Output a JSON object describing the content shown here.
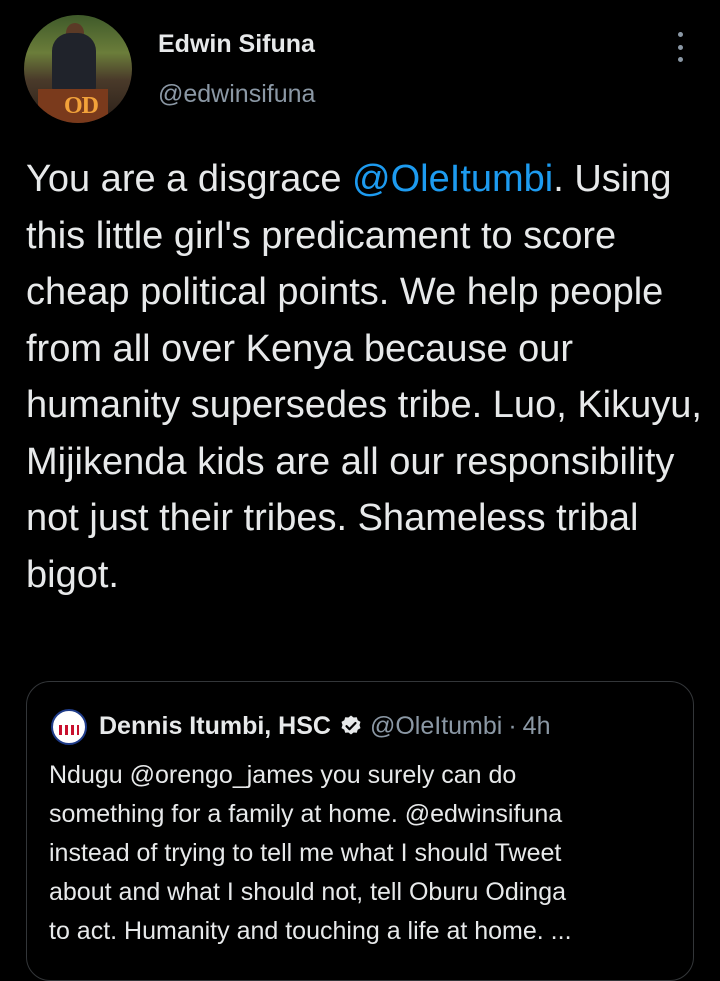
{
  "tweet": {
    "author_name": "Edwin Sifuna",
    "author_handle": "@edwinsifuna",
    "avatar_podium_text": "OD",
    "text_before": "You are a disgrace ",
    "mention": "@OleItumbi",
    "text_after": ". Using this little girl's predicament to score cheap political points. We help people from all over Kenya because our humanity supersedes tribe. Luo, Kikuyu, Mijikenda kids are all our responsibility not just their tribes. Shameless tribal bigot."
  },
  "quoted_tweet": {
    "author_name": "Dennis Itumbi, HSC",
    "author_handle": "@OleItumbi",
    "separator": "·",
    "time": "4h",
    "lines": [
      "Ndugu @orengo_james you surely can do",
      "something for a family at home. @edwinsifuna",
      "instead of trying to tell me what I should Tweet",
      "about and what I should not, tell Oburu Odinga",
      "to act. Humanity and touching a life at home. ..."
    ]
  },
  "icons": {
    "more": "more-vertical-icon",
    "verified": "verified-badge-icon"
  },
  "colors": {
    "background": "#000000",
    "text": "#e7e9ea",
    "secondary": "#8b98a5",
    "link": "#1d9bf0",
    "border": "#333639"
  }
}
